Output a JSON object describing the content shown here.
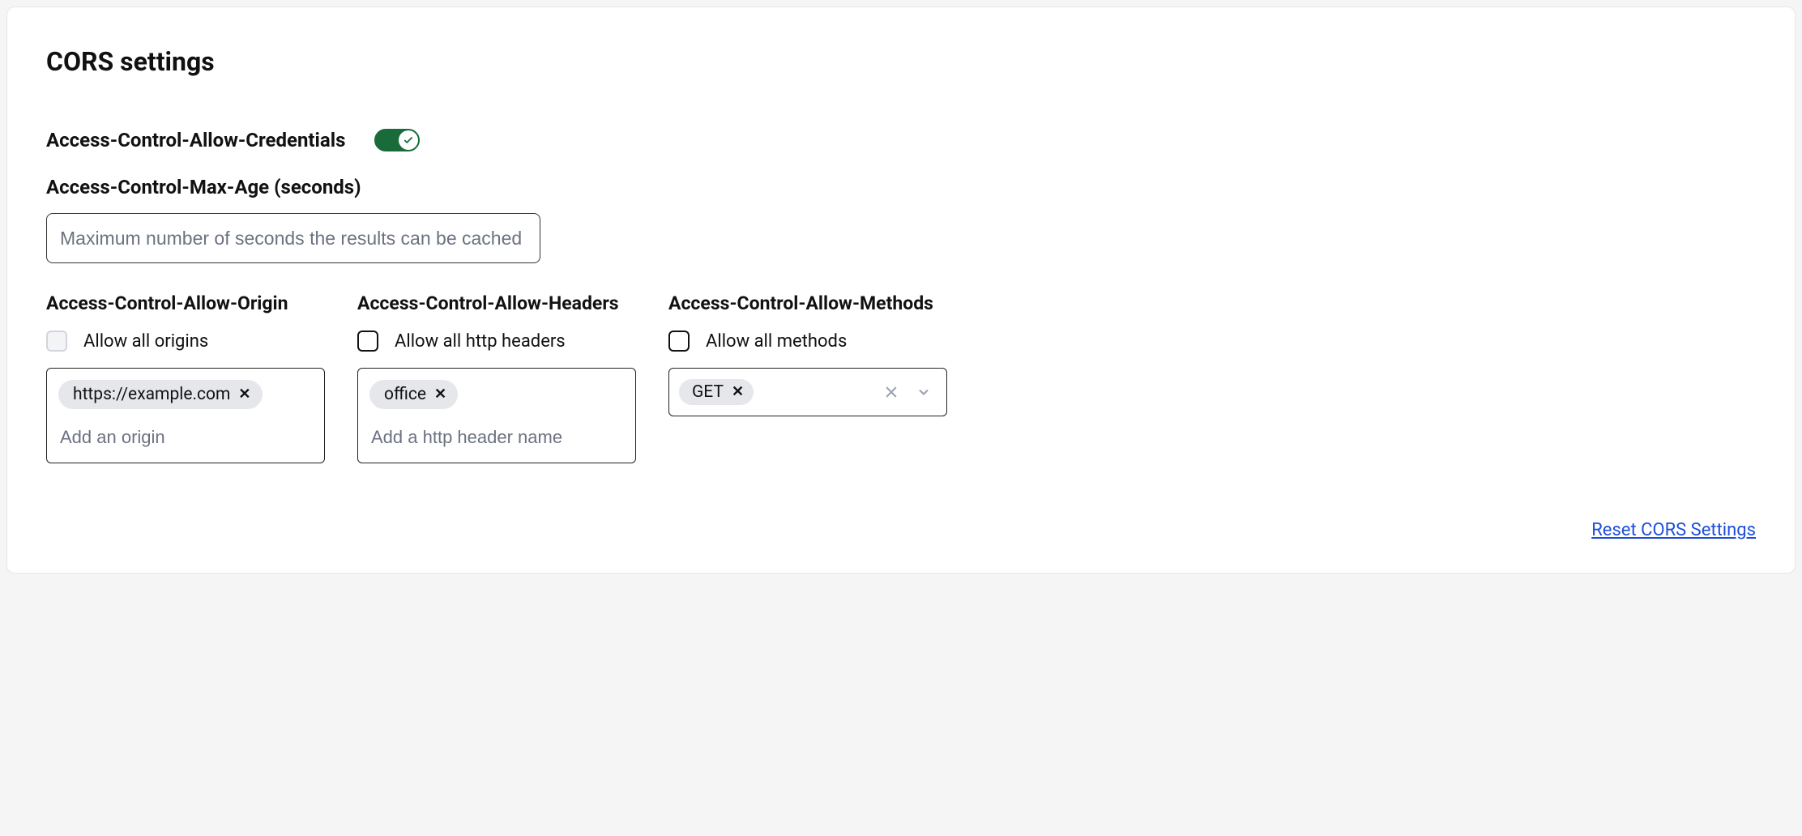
{
  "title": "CORS settings",
  "credentials": {
    "label": "Access-Control-Allow-Credentials",
    "enabled": true
  },
  "max_age": {
    "label": "Access-Control-Max-Age (seconds)",
    "placeholder": "Maximum number of seconds the results can be cached",
    "value": ""
  },
  "origin": {
    "label": "Access-Control-Allow-Origin",
    "allow_all_label": "Allow all origins",
    "allow_all_checked": false,
    "allow_all_disabled": true,
    "tags": [
      "https://example.com"
    ],
    "placeholder": "Add an origin"
  },
  "headers": {
    "label": "Access-Control-Allow-Headers",
    "allow_all_label": "Allow all http headers",
    "allow_all_checked": false,
    "tags": [
      "office"
    ],
    "placeholder": "Add a http header name"
  },
  "methods": {
    "label": "Access-Control-Allow-Methods",
    "allow_all_label": "Allow all methods",
    "allow_all_checked": false,
    "tags": [
      "GET"
    ]
  },
  "reset_label": "Reset CORS Settings",
  "colors": {
    "toggle_on": "#1a6b3a",
    "link": "#1d4ed8"
  }
}
